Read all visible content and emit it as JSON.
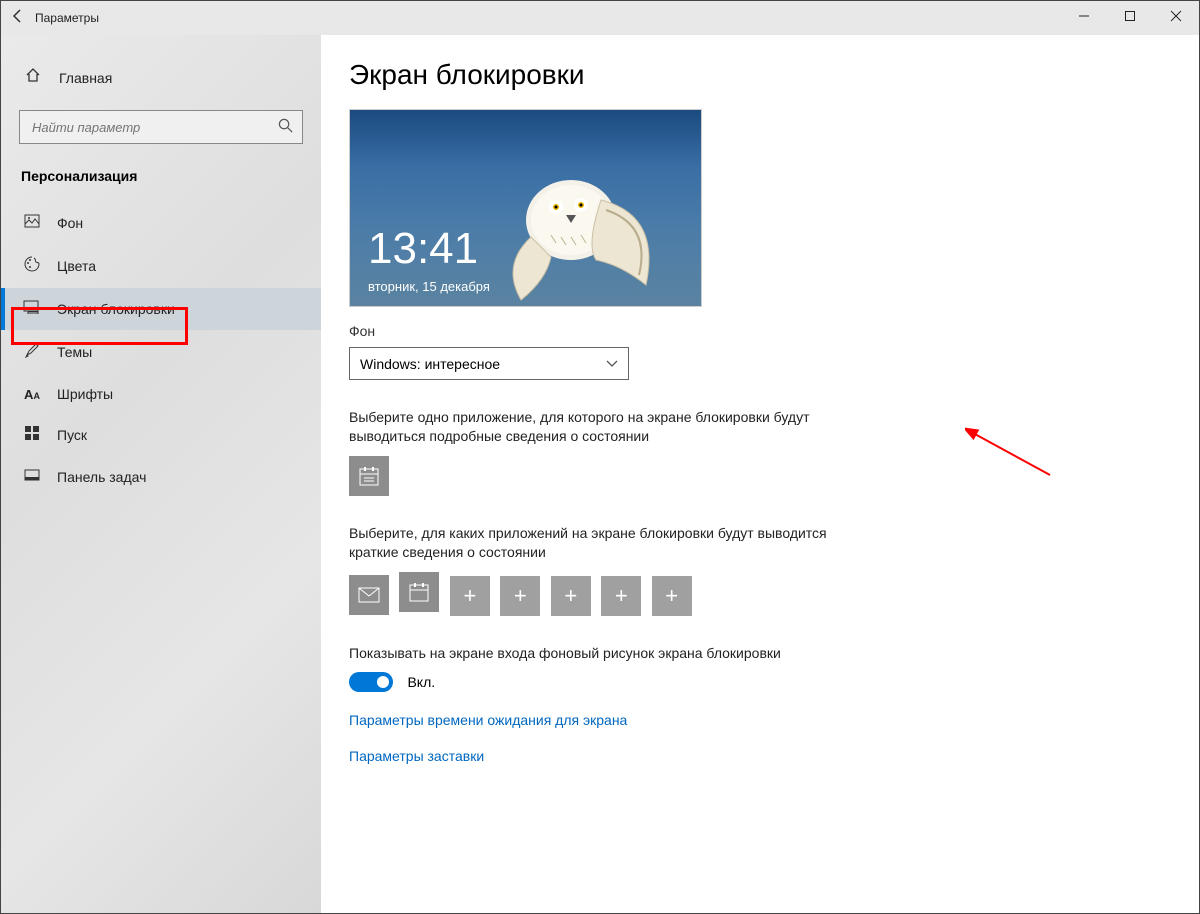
{
  "window": {
    "title": "Параметры"
  },
  "sidebar": {
    "home": "Главная",
    "search_placeholder": "Найти параметр",
    "category": "Персонализация",
    "items": [
      {
        "label": "Фон"
      },
      {
        "label": "Цвета"
      },
      {
        "label": "Экран блокировки"
      },
      {
        "label": "Темы"
      },
      {
        "label": "Шрифты"
      },
      {
        "label": "Пуск"
      },
      {
        "label": "Панель задач"
      }
    ]
  },
  "main": {
    "heading": "Экран блокировки",
    "preview": {
      "time": "13:41",
      "date": "вторник, 15 декабря"
    },
    "bg_label": "Фон",
    "bg_value": "Windows: интересное",
    "detailed_label": "Выберите одно приложение, для которого на экране блокировки будут выводиться подробные сведения о состоянии",
    "quick_label": "Выберите, для каких приложений на экране блокировки будут выводится краткие сведения о состоянии",
    "toggle_label": "Показывать на экране входа фоновый рисунок экрана блокировки",
    "toggle_state": "Вкл.",
    "link1": "Параметры времени ожидания для экрана",
    "link2": "Параметры заставки"
  }
}
